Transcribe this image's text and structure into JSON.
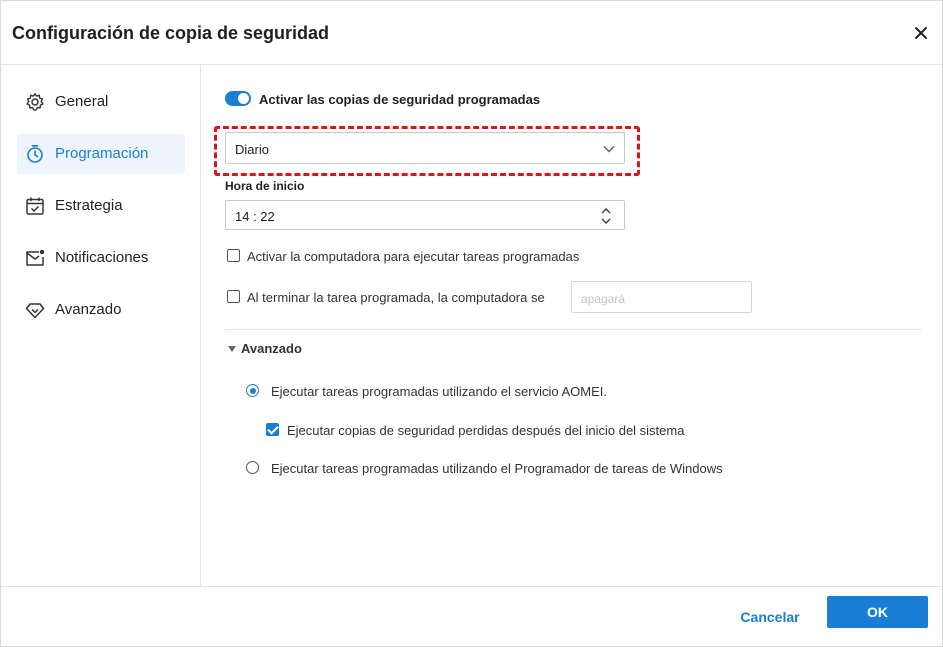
{
  "window": {
    "title": "Configuración de copia de seguridad"
  },
  "sidebar": {
    "items": [
      {
        "label": "General",
        "icon": "gear-icon",
        "active": false
      },
      {
        "label": "Programación",
        "icon": "timer-icon",
        "active": true
      },
      {
        "label": "Estrategia",
        "icon": "calendar-check-icon",
        "active": false
      },
      {
        "label": "Notificaciones",
        "icon": "mail-notification-icon",
        "active": false
      },
      {
        "label": "Avanzado",
        "icon": "diamond-icon",
        "active": false
      }
    ]
  },
  "schedule": {
    "enable_label": "Activar las copias de seguridad programadas",
    "enabled": true,
    "frequency_value": "Diario",
    "start_time_label": "Hora de inicio",
    "start_time_value": "14 : 22",
    "wake_label": "Activar la computadora para ejecutar tareas programadas",
    "wake_checked": false,
    "after_task_label": "Al terminar la tarea programada, la computadora se",
    "after_task_checked": false,
    "after_task_placeholder": "apagará"
  },
  "advanced": {
    "heading": "Avanzado",
    "option_aomei": "Ejecutar tareas programadas utilizando el servicio AOMEI.",
    "option_aomei_selected": true,
    "missed_label": "Ejecutar copias de seguridad perdidas después del inicio del sistema",
    "missed_checked": true,
    "option_windows": "Ejecutar tareas programadas utilizando el Programador de tareas de Windows",
    "option_windows_selected": false
  },
  "footer": {
    "cancel_label": "Cancelar",
    "ok_label": "OK"
  },
  "colors": {
    "accent": "#1a7fd4",
    "highlight": "#d9161c",
    "active_bg": "#eef4fb"
  }
}
